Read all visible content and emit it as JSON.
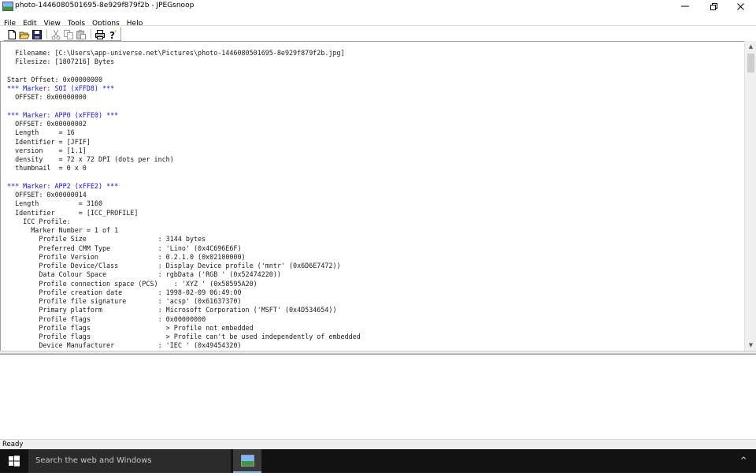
{
  "window": {
    "title": "photo-1446080501695-8e929f879f2b - JPEGsnoop",
    "controls": {
      "minimize": "─",
      "maximize": "❐",
      "close": "✕"
    }
  },
  "menubar": {
    "items": [
      {
        "label": "File"
      },
      {
        "label": "Edit"
      },
      {
        "label": "View"
      },
      {
        "label": "Tools"
      },
      {
        "label": "Options"
      },
      {
        "label": "Help"
      }
    ]
  },
  "toolbar": {
    "buttons": [
      "new-file-icon",
      "open-folder-icon",
      "save-icon",
      "cut-icon",
      "copy-icon",
      "paste-icon",
      "print-icon",
      "help-icon"
    ]
  },
  "output": {
    "lines": [
      {
        "text": "  Filename: [C:\\Users\\app-universe.net\\Pictures\\photo-1446080501695-8e929f879f2b.jpg]",
        "color": "normal"
      },
      {
        "text": "  Filesize: [1807216] Bytes",
        "color": "normal"
      },
      {
        "text": "",
        "color": "normal"
      },
      {
        "text": "Start Offset: 0x00000000",
        "color": "normal"
      },
      {
        "text": "*** Marker: SOI (xFFD8) ***",
        "color": "blue"
      },
      {
        "text": "  OFFSET: 0x00000000",
        "color": "normal"
      },
      {
        "text": "",
        "color": "normal"
      },
      {
        "text": "*** Marker: APP0 (xFFE0) ***",
        "color": "blue"
      },
      {
        "text": "  OFFSET: 0x00000002",
        "color": "normal"
      },
      {
        "text": "  Length     = 16",
        "color": "normal"
      },
      {
        "text": "  Identifier = [JFIF]",
        "color": "normal"
      },
      {
        "text": "  version    = [1.1]",
        "color": "normal"
      },
      {
        "text": "  density    = 72 x 72 DPI (dots per inch)",
        "color": "normal"
      },
      {
        "text": "  thumbnail  = 0 x 0",
        "color": "normal"
      },
      {
        "text": "",
        "color": "normal"
      },
      {
        "text": "*** Marker: APP2 (xFFE2) ***",
        "color": "blue"
      },
      {
        "text": "  OFFSET: 0x00000014",
        "color": "normal"
      },
      {
        "text": "  Length          = 3160",
        "color": "normal"
      },
      {
        "text": "  Identifier      = [ICC_PROFILE]",
        "color": "normal"
      },
      {
        "text": "    ICC Profile:",
        "color": "normal"
      },
      {
        "text": "      Marker Number = 1 of 1",
        "color": "normal"
      },
      {
        "text": "        Profile Size                  : 3144 bytes",
        "color": "normal"
      },
      {
        "text": "        Preferred CMM Type            : 'Lino' (0x4C696E6F)",
        "color": "normal"
      },
      {
        "text": "        Profile Version               : 0.2.1.0 (0x02100000)",
        "color": "normal"
      },
      {
        "text": "        Profile Device/Class          : Display Device profile ('mntr' (0x6D6E7472))",
        "color": "normal"
      },
      {
        "text": "        Data Colour Space             : rgbData ('RGB ' (0x52474220))",
        "color": "normal"
      },
      {
        "text": "        Profile connection space (PCS)    : 'XYZ ' (0x58595A20)",
        "color": "normal"
      },
      {
        "text": "        Profile creation date         : 1998-02-09 06:49:00",
        "color": "normal"
      },
      {
        "text": "        Profile file signature        : 'acsp' (0x61637370)",
        "color": "normal"
      },
      {
        "text": "        Primary platform              : Microsoft Corporation ('MSFT' (0x4D534654))",
        "color": "normal"
      },
      {
        "text": "        Profile flags                 : 0x00000000",
        "color": "normal"
      },
      {
        "text": "        Profile flags                   > Profile not embedded",
        "color": "normal"
      },
      {
        "text": "        Profile flags                   > Profile can't be used independently of embedded",
        "color": "normal"
      },
      {
        "text": "        Device Manufacturer           : 'IEC ' (0x49454320)",
        "color": "normal"
      }
    ]
  },
  "scrollbar": {
    "up_arrow": "▲",
    "down_arrow": "▼"
  },
  "statusbar": {
    "text": "Ready"
  },
  "taskbar": {
    "search_placeholder": "Search the web and Windows",
    "tray_chevron": "^"
  },
  "colors": {
    "blue_text": "#1010e0",
    "normal_text": "#1a1a1a",
    "taskbar": "#121212"
  }
}
